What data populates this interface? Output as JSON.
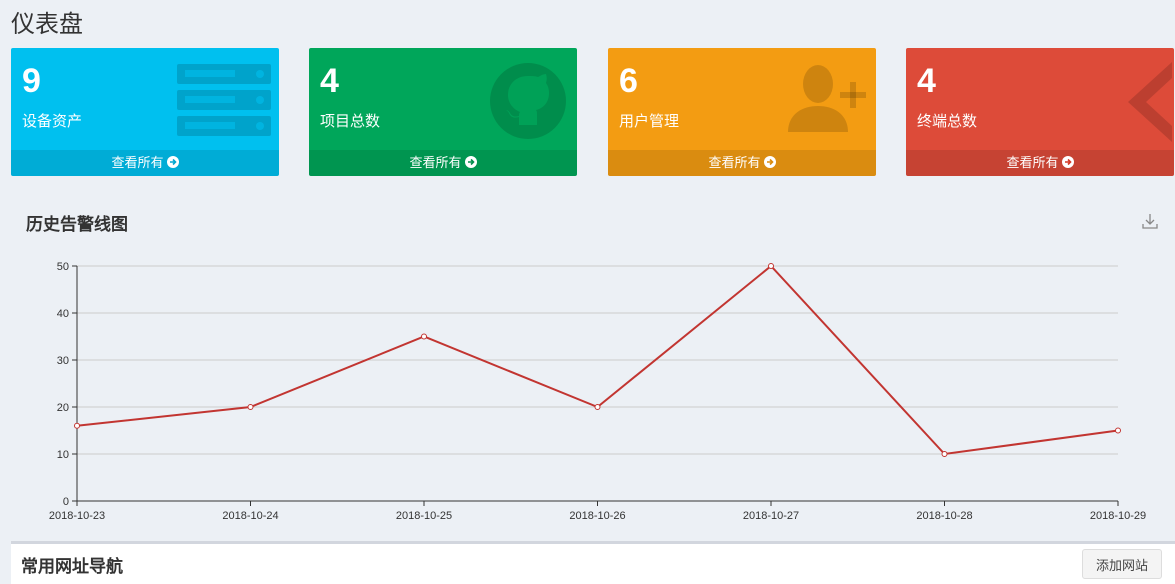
{
  "page": {
    "title": "仪表盘"
  },
  "cards": [
    {
      "value": "9",
      "label": "设备资产",
      "link": "查看所有",
      "color": "#00c0ef",
      "icon": "server-icon"
    },
    {
      "value": "4",
      "label": "项目总数",
      "link": "查看所有",
      "color": "#00a65a",
      "icon": "github-icon"
    },
    {
      "value": "6",
      "label": "用户管理",
      "link": "查看所有",
      "color": "#f39c12",
      "icon": "user-add-icon"
    },
    {
      "value": "4",
      "label": "终端总数",
      "link": "查看所有",
      "color": "#dd4b39",
      "icon": "chevron-left-icon"
    }
  ],
  "chart_data": {
    "type": "line",
    "title": "历史告警线图",
    "x": [
      "2018-10-23",
      "2018-10-24",
      "2018-10-25",
      "2018-10-26",
      "2018-10-27",
      "2018-10-28",
      "2018-10-29"
    ],
    "series": [
      {
        "values": [
          16,
          20,
          35,
          20,
          50,
          10,
          15
        ],
        "color": "#c23531"
      }
    ],
    "ylim": [
      0,
      50
    ],
    "yticks": [
      0,
      10,
      20,
      30,
      40,
      50
    ],
    "grid": true
  },
  "nav": {
    "title": "常用网址导航",
    "add_label": "添加网站"
  }
}
